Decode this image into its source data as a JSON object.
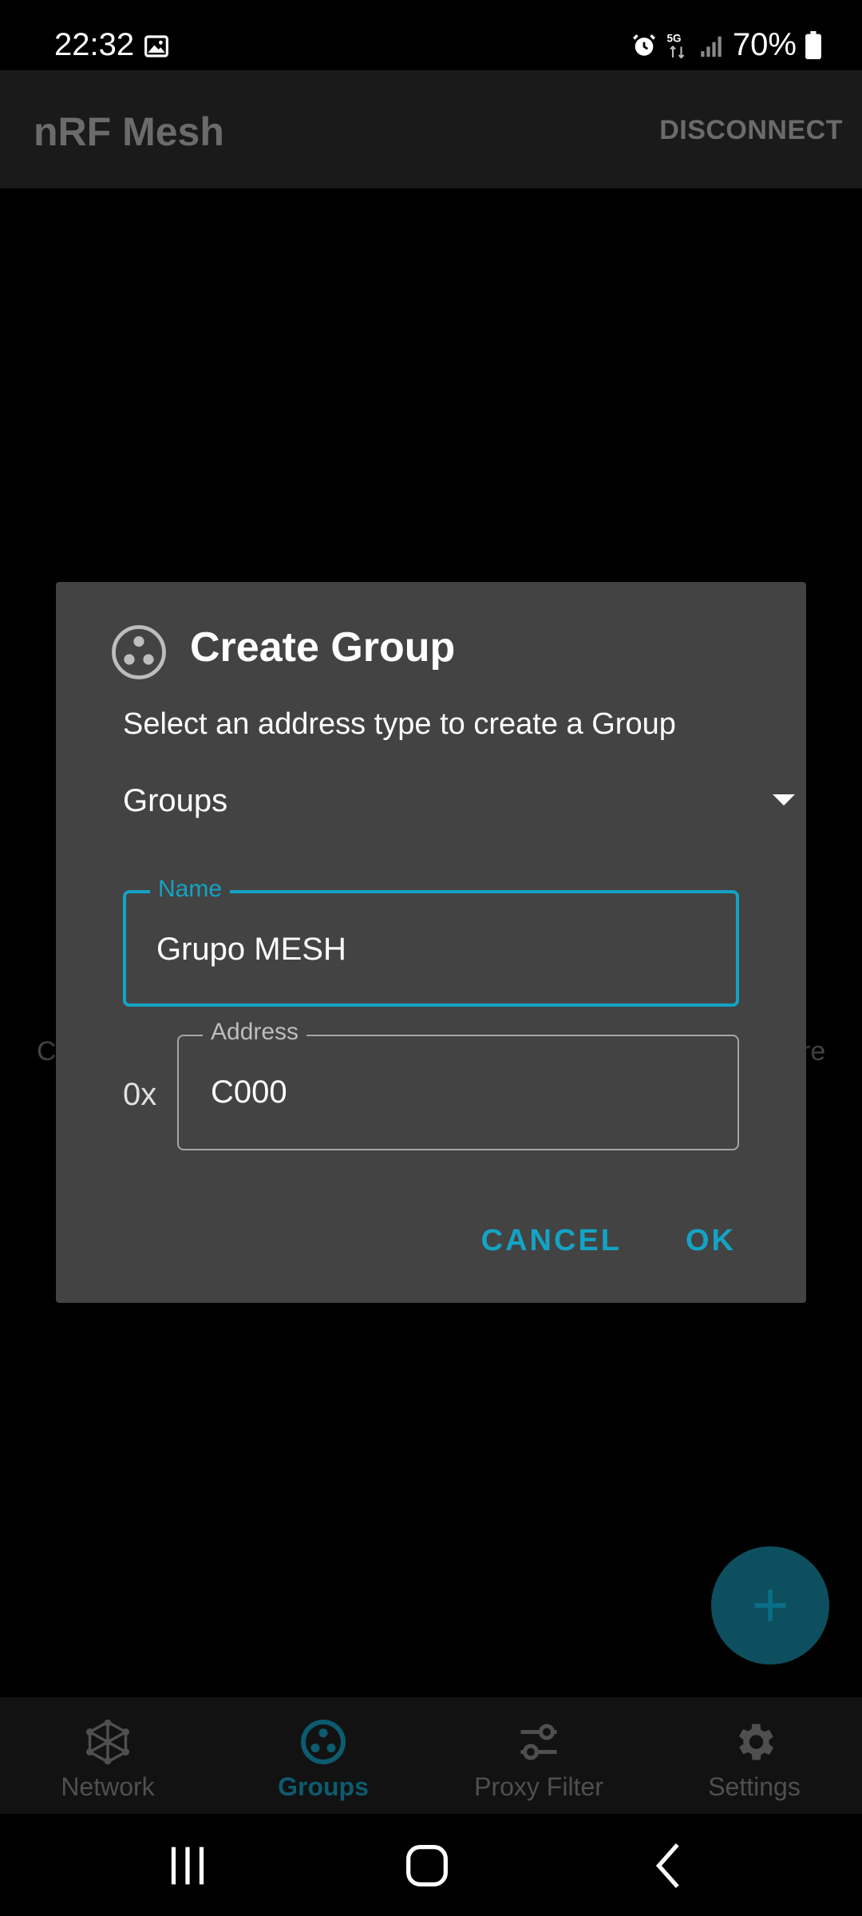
{
  "status_bar": {
    "time": "22:32",
    "network": "5G",
    "battery": "70%"
  },
  "app_bar": {
    "title": "nRF Mesh",
    "action": "DISCONNECT"
  },
  "background": {
    "hint_left_fragment": "C",
    "hint_right_fragment": "re"
  },
  "dialog": {
    "title": "Create Group",
    "icon": "group-icon",
    "subtitle": "Select an address type to create a Group",
    "address_type": {
      "selected": "Groups"
    },
    "name_field": {
      "label": "Name",
      "value": "Grupo MESH"
    },
    "address_field": {
      "prefix": "0x",
      "label": "Address",
      "value": "C000"
    },
    "buttons": {
      "cancel": "CANCEL",
      "ok": "OK"
    }
  },
  "fab": {
    "icon": "plus-icon"
  },
  "bottom_nav": {
    "items": [
      {
        "label": "Network",
        "icon": "network-icon",
        "active": false
      },
      {
        "label": "Groups",
        "icon": "groups-icon",
        "active": true
      },
      {
        "label": "Proxy Filter",
        "icon": "proxy-filter-icon",
        "active": false
      },
      {
        "label": "Settings",
        "icon": "settings-icon",
        "active": false
      }
    ]
  },
  "colors": {
    "accent": "#14a3c4",
    "dialog_bg": "#434343",
    "fab_bg": "#0d4f5f"
  }
}
